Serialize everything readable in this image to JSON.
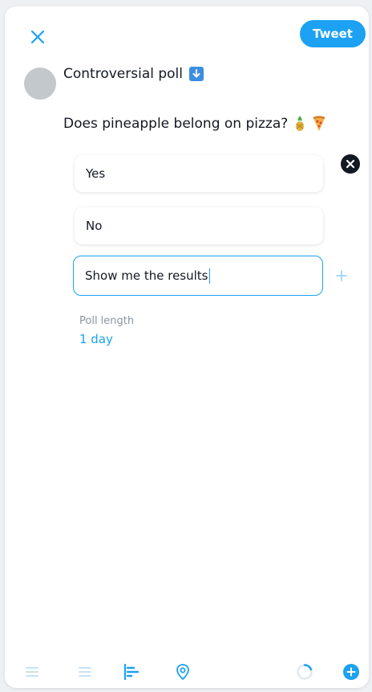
{
  "header": {
    "close_icon": "close-icon",
    "tweet_label": "Tweet"
  },
  "compose": {
    "title": "Controversial poll",
    "title_emoji": "down-arrow-emoji",
    "question": "Does pineapple belong on pizza?",
    "question_emojis": [
      "pineapple-emoji",
      "pizza-emoji"
    ]
  },
  "poll": {
    "choices": [
      {
        "value": "Yes"
      },
      {
        "value": "No"
      },
      {
        "value": "Show me the results"
      }
    ],
    "length_label": "Poll length",
    "length_value": "1 day"
  },
  "toolbar": {
    "icons": [
      "image-icon",
      "gif-icon",
      "poll-icon",
      "location-icon",
      "progress-ring-icon",
      "add-tweet-icon"
    ]
  },
  "colors": {
    "accent": "#1da1f2",
    "text": "#141823",
    "muted": "#8a95a0",
    "avatar": "#c3c8cc"
  }
}
